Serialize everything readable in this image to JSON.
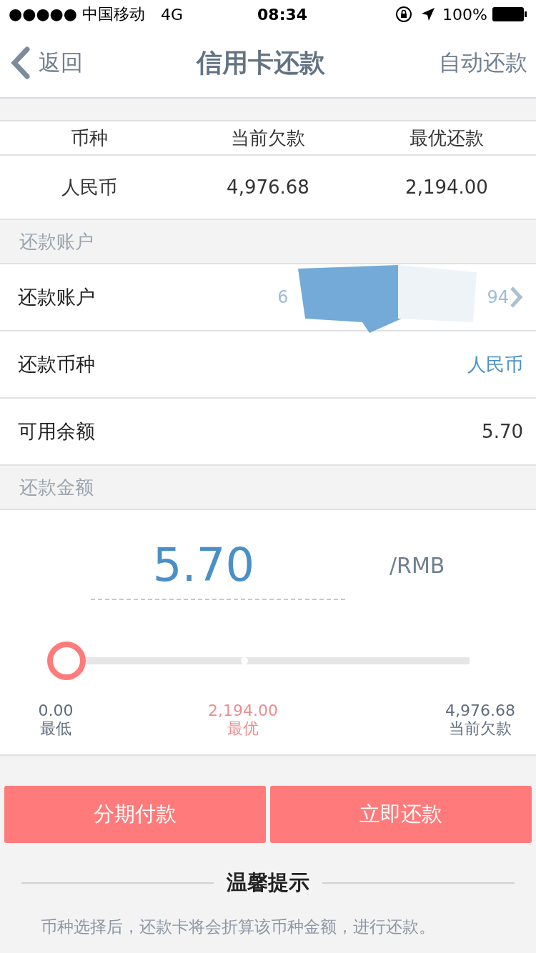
{
  "status_bar": {
    "carrier": "●●●●● 中国移动",
    "network": "4G",
    "time": "08:34",
    "battery": "100%"
  },
  "nav": {
    "back": "返回",
    "title": "信用卡还款",
    "action": "自动还款"
  },
  "debt_table": {
    "columns": [
      "币种",
      "当前欠款",
      "最优还款"
    ],
    "rows": [
      [
        "人民币",
        "4,976.68",
        "2,194.00"
      ]
    ]
  },
  "account_section": {
    "header": "还款账户",
    "rows": [
      {
        "kind": "account",
        "label": "还款账户",
        "value_start": "6",
        "value_end": "94"
      },
      {
        "kind": "link",
        "label": "还款币种",
        "value": "人民币"
      },
      {
        "kind": "plain",
        "label": "可用余额",
        "value": "5.70"
      }
    ]
  },
  "amount_section": {
    "header": "还款金额",
    "amount": "5.70",
    "unit": "/RMB",
    "slider": {
      "level": 0,
      "marks": [
        {
          "value": "0.00",
          "label": "最低",
          "kind": "min"
        },
        {
          "value": "2,194.00",
          "label": "最优",
          "kind": "best"
        },
        {
          "value": "4,976.68",
          "label": "当前欠款",
          "kind": "max"
        }
      ]
    }
  },
  "buttons": [
    "分期付款",
    "立即还款"
  ],
  "tips": {
    "title": "温馨提示",
    "lines": [
      "币种选择后，还款卡将会折算该币种金额，进行还款。"
    ]
  }
}
